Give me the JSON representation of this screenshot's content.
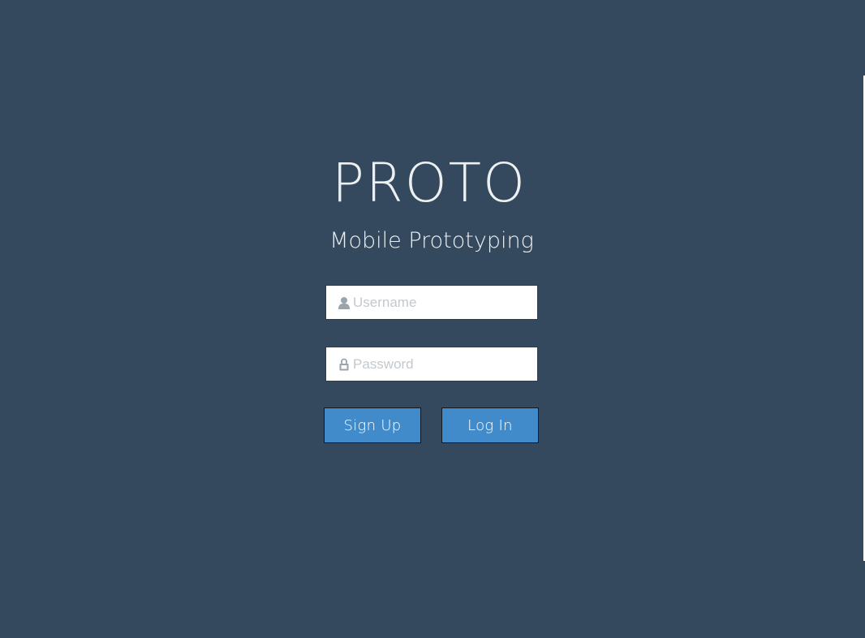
{
  "app": {
    "title": "PROTO",
    "subtitle": "Mobile Prototyping"
  },
  "form": {
    "username": {
      "placeholder": "Username",
      "value": "",
      "icon": "user-icon"
    },
    "password": {
      "placeholder": "Password",
      "value": "",
      "icon": "lock-icon"
    }
  },
  "actions": {
    "signup_label": "Sign Up",
    "login_label": "Log In"
  },
  "colors": {
    "background": "#34495e",
    "button": "#428bca",
    "text_light": "#ecf0f1",
    "placeholder": "#c3c9cf"
  }
}
